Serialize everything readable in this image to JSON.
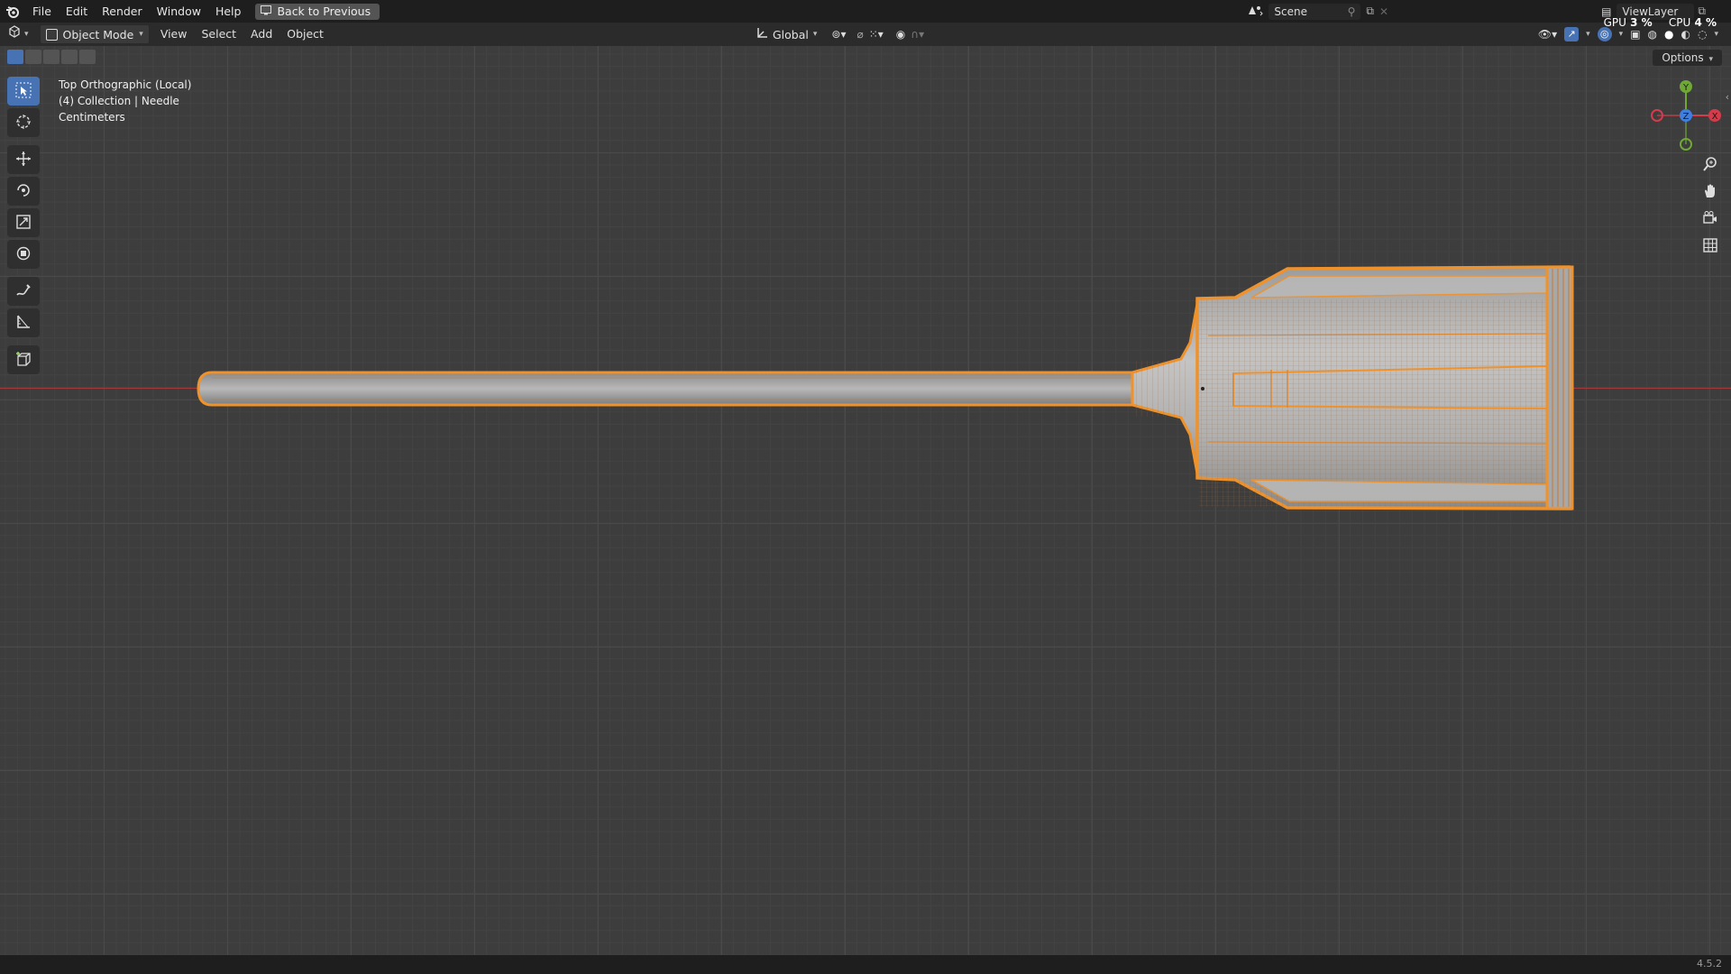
{
  "app": {
    "version": "4.5.2"
  },
  "menu": [
    "File",
    "Edit",
    "Render",
    "Window",
    "Help"
  ],
  "back_button": "Back to Previous",
  "scene": {
    "label": "Scene"
  },
  "view_layer": {
    "label": "ViewLayer"
  },
  "perf": {
    "gpu_label": "GPU",
    "gpu_value": "3 %",
    "cpu_label": "CPU",
    "cpu_value": "4 %"
  },
  "header": {
    "mode": "Object Mode",
    "menus": [
      "View",
      "Select",
      "Add",
      "Object"
    ],
    "orientation": "Global"
  },
  "viewport": {
    "view_name": "Top Orthographic (Local)",
    "collection": "(4) Collection | Needle",
    "units": "Centimeters",
    "options_label": "Options"
  },
  "gizmo": {
    "y": "Y",
    "z": "Z",
    "x": "X"
  },
  "colors": {
    "selection": "#f0922b",
    "accent": "#4772b3",
    "x_axis": "#a33a3a"
  }
}
